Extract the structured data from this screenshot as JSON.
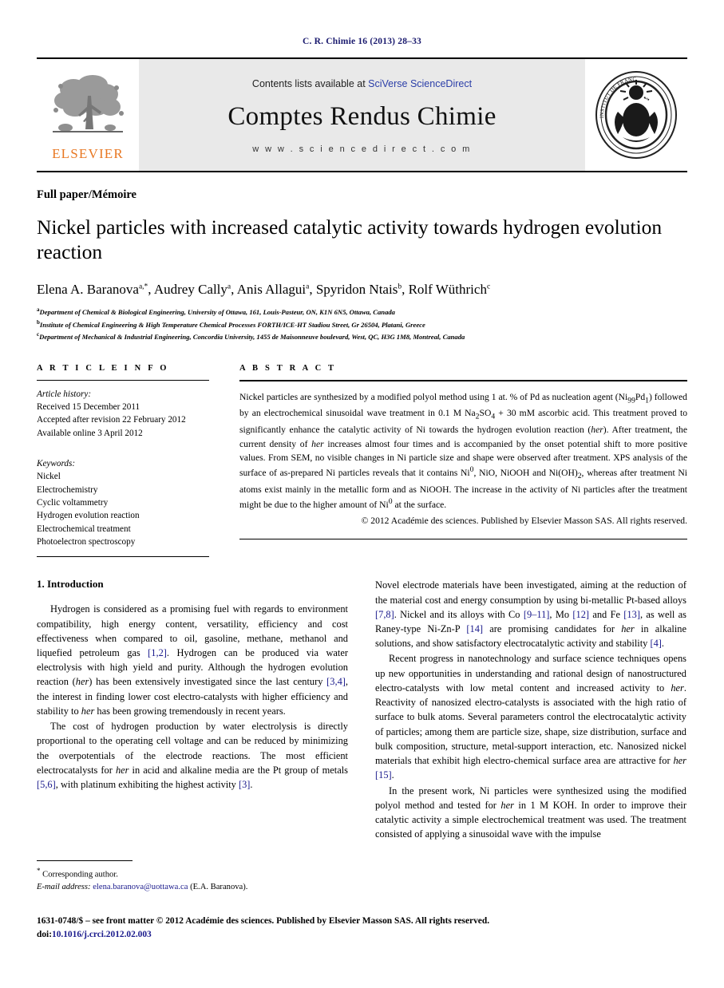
{
  "running_head": "C. R. Chimie 16 (2013) 28–33",
  "masthead": {
    "contents_prefix": "Contents lists available at ",
    "sciencedirect_link": "SciVerse ScienceDirect",
    "journal_title": "Comptes Rendus Chimie",
    "website": "w w w . s c i e n c e d i r e c t . c o m",
    "publisher_logo_text": "ELSEVIER",
    "seal_text_top": "INSTITUT DE FRANCE",
    "seal_text_right": "ACADÉMIE DES SCIENCES",
    "seal_year": "1666"
  },
  "article": {
    "kind": "Full paper/Mémoire",
    "title": "Nickel particles with increased catalytic activity towards hydrogen evolution reaction",
    "authors_html": "Elena A. Baranova<sup>a,*</sup>, Audrey Cally<sup>a</sup>, Anis Allagui<sup>a</sup>, Spyridon Ntais<sup>b</sup>, Rolf Wüthrich<sup>c</sup>",
    "affiliations": [
      "Department of Chemical & Biological Engineering, University of Ottawa, 161, Louis-Pasteur, ON, K1N 6N5, Ottawa, Canada",
      "Institute of Chemical Engineering & High Temperature Chemical Processes FORTH/ICE-HT Stadiou Street, Gr 26504, Platani, Greece",
      "Department of Mechanical & Industrial Engineering, Concordia University, 1455 de Maisonneuve boulevard, West, QC, H3G 1M8, Montreal, Canada"
    ],
    "affiliation_marks": [
      "a",
      "b",
      "c"
    ]
  },
  "article_info": {
    "heading": "A R T I C L E   I N F O",
    "history_label": "Article history:",
    "history": [
      "Received 15 December 2011",
      "Accepted after revision 22 February 2012",
      "Available online 3 April 2012"
    ],
    "keywords_label": "Keywords:",
    "keywords": [
      "Nickel",
      "Electrochemistry",
      "Cyclic voltammetry",
      "Hydrogen evolution reaction",
      "Electrochemical treatment",
      "Photoelectron spectroscopy"
    ]
  },
  "abstract": {
    "heading": "A B S T R A C T",
    "body_html": "Nickel particles are synthesized by a modified polyol method using 1 at. % of Pd as nucleation agent (Ni<sub>99</sub>Pd<sub>1</sub>) followed by an electrochemical sinusoidal wave treatment in 0.1 M Na<sub>2</sub>SO<sub>4</sub> + 30 mM ascorbic acid. This treatment proved to significantly enhance the catalytic activity of Ni towards the hydrogen evolution reaction (<i>her</i>). After treatment, the current density of <i>her</i> increases almost four times and is accompanied by the onset potential shift to more positive values. From SEM, no visible changes in Ni particle size and shape were observed after treatment. XPS analysis of the surface of as-prepared Ni particles reveals that it contains Ni<sup>0</sup>, NiO, NiOOH and Ni(OH)<sub>2</sub>, whereas after treatment Ni atoms exist mainly in the metallic form and as NiOOH. The increase in the activity of Ni particles after the treatment might be due to the higher amount of Ni<sup>0</sup> at the surface.",
    "copyright": "© 2012 Académie des sciences. Published by Elsevier Masson SAS. All rights reserved."
  },
  "body": {
    "section_1_heading": "1. Introduction",
    "left_paragraphs_html": [
      "Hydrogen is considered as a promising fuel with regards to environment compatibility, high energy content, versatility, efficiency and cost effectiveness when compared to oil, gasoline, methane, methanol and liquefied petroleum gas <span class=\"cite\">[1,2]</span>. Hydrogen can be produced via water electrolysis with high yield and purity. Although the hydrogen evolution reaction (<i>her</i>) has been extensively investigated since the last century <span class=\"cite\">[3,4]</span>, the interest in finding lower cost electro-catalysts with higher efficiency and stability to <i>her</i> has been growing tremendously in recent years.",
      "The cost of hydrogen production by water electrolysis is directly proportional to the operating cell voltage and can be reduced by minimizing the overpotentials of the electrode reactions. The most efficient electrocatalysts for <i>her</i> in acid and alkaline media are the Pt group of metals <span class=\"cite\">[5,6]</span>, with platinum exhibiting the highest activity <span class=\"cite\">[3]</span>."
    ],
    "right_paragraphs_html": [
      "Novel electrode materials have been investigated, aiming at the reduction of the material cost and energy consumption by using bi-metallic Pt-based alloys <span class=\"cite\">[7,8]</span>. Nickel and its alloys with Co <span class=\"cite\">[9–11]</span>, Mo <span class=\"cite\">[12]</span> and Fe <span class=\"cite\">[13]</span>, as well as Raney-type Ni-Zn-P <span class=\"cite\">[14]</span> are promising candidates for <i>her</i> in alkaline solutions, and show satisfactory electrocatalytic activity and stability <span class=\"cite\">[4]</span>.",
      "Recent progress in nanotechnology and surface science techniques opens up new opportunities in understanding and rational design of nanostructured electro-catalysts with low metal content and increased activity to <i>her</i>. Reactivity of nanosized electro-catalysts is associated with the high ratio of surface to bulk atoms. Several parameters control the electrocatalytic activity of particles; among them are particle size, shape, size distribution, surface and bulk composition, structure, metal-support interaction, etc. Nanosized nickel materials that exhibit high electro-chemical surface area are attractive for <i>her</i> <span class=\"cite\">[15]</span>.",
      "In the present work, Ni particles were synthesized using the modified polyol method and tested for <i>her</i> in 1 M KOH. In order to improve their catalytic activity a simple electrochemical treatment was used. The treatment consisted of applying a sinusoidal wave with the impulse"
    ]
  },
  "footnote": {
    "corresponding_mark": "*",
    "corresponding_text": "Corresponding author.",
    "email_label": "E-mail address:",
    "email": "elena.baranova@uottawa.ca",
    "email_owner": "(E.A. Baranova)."
  },
  "footer": {
    "issn_line": "1631-0748/$ – see front matter © 2012 Académie des sciences. Published by Elsevier Masson SAS. All rights reserved.",
    "doi_label": "doi:",
    "doi_value": "10.1016/j.crci.2012.02.003"
  }
}
